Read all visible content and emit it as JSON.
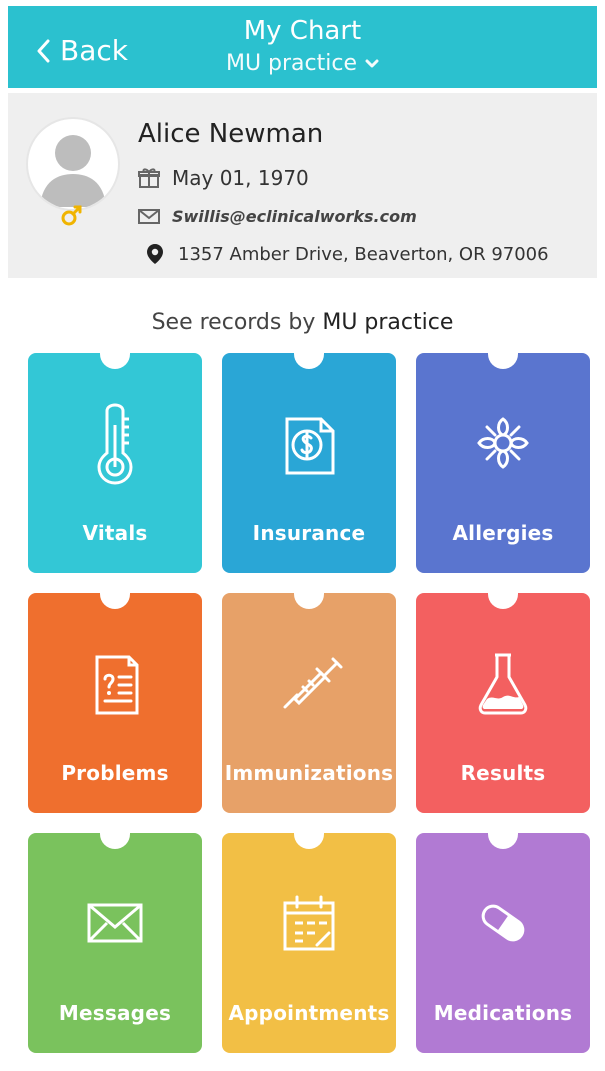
{
  "header": {
    "back_label": "Back",
    "title": "My Chart",
    "subtitle": "MU practice"
  },
  "profile": {
    "name": "Alice Newman",
    "dob": "May 01, 1970",
    "email": "Swillis@eclinicalworks.com",
    "address": "1357 Amber Drive, Beaverton, OR 97006"
  },
  "records": {
    "title_prefix": "See records by",
    "title_strong": "MU practice"
  },
  "tiles": [
    {
      "label": "Vitals",
      "color": "#33c7d6"
    },
    {
      "label": "Insurance",
      "color": "#2aa6d6"
    },
    {
      "label": "Allergies",
      "color": "#5a75cf"
    },
    {
      "label": "Problems",
      "color": "#ef6f2e"
    },
    {
      "label": "Immunizations",
      "color": "#e7a168"
    },
    {
      "label": "Results",
      "color": "#f36060"
    },
    {
      "label": "Messages",
      "color": "#7ac25d"
    },
    {
      "label": "Appointments",
      "color": "#f2bf45"
    },
    {
      "label": "Medications",
      "color": "#b17ad3"
    }
  ],
  "icons": [
    "thermometer-icon",
    "insurance-document-icon",
    "flower-icon",
    "problem-document-icon",
    "syringe-icon",
    "flask-icon",
    "envelope-icon",
    "calendar-icon",
    "pill-icon"
  ]
}
